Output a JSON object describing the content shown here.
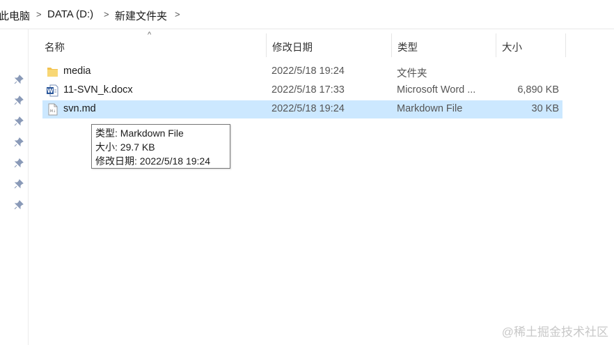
{
  "breadcrumb": {
    "items": [
      "此电脑",
      "DATA (D:)",
      "新建文件夹"
    ]
  },
  "columns": {
    "name": "名称",
    "date": "修改日期",
    "type": "类型",
    "size": "大小"
  },
  "files": [
    {
      "name": "media",
      "date": "2022/5/18 19:24",
      "type": "文件夹",
      "size": "",
      "icon": "folder-icon"
    },
    {
      "name": "11-SVN_k.docx",
      "date": "2022/5/18 17:33",
      "type": "Microsoft Word ...",
      "size": "6,890 KB",
      "icon": "word-document-icon"
    },
    {
      "name": "svn.md",
      "date": "2022/5/18 19:24",
      "type": "Markdown File",
      "size": "30 KB",
      "icon": "markdown-file-icon"
    }
  ],
  "tooltip": {
    "type_line": "类型: Markdown File",
    "size_line": "大小: 29.7 KB",
    "date_line": "修改日期: 2022/5/18 19:24"
  },
  "watermark": "@稀土掘金技术社区",
  "colors": {
    "selection": "#cce8ff",
    "folder": "#f3c24f",
    "word": "#2b579a",
    "pin": "#8a9ab8"
  }
}
